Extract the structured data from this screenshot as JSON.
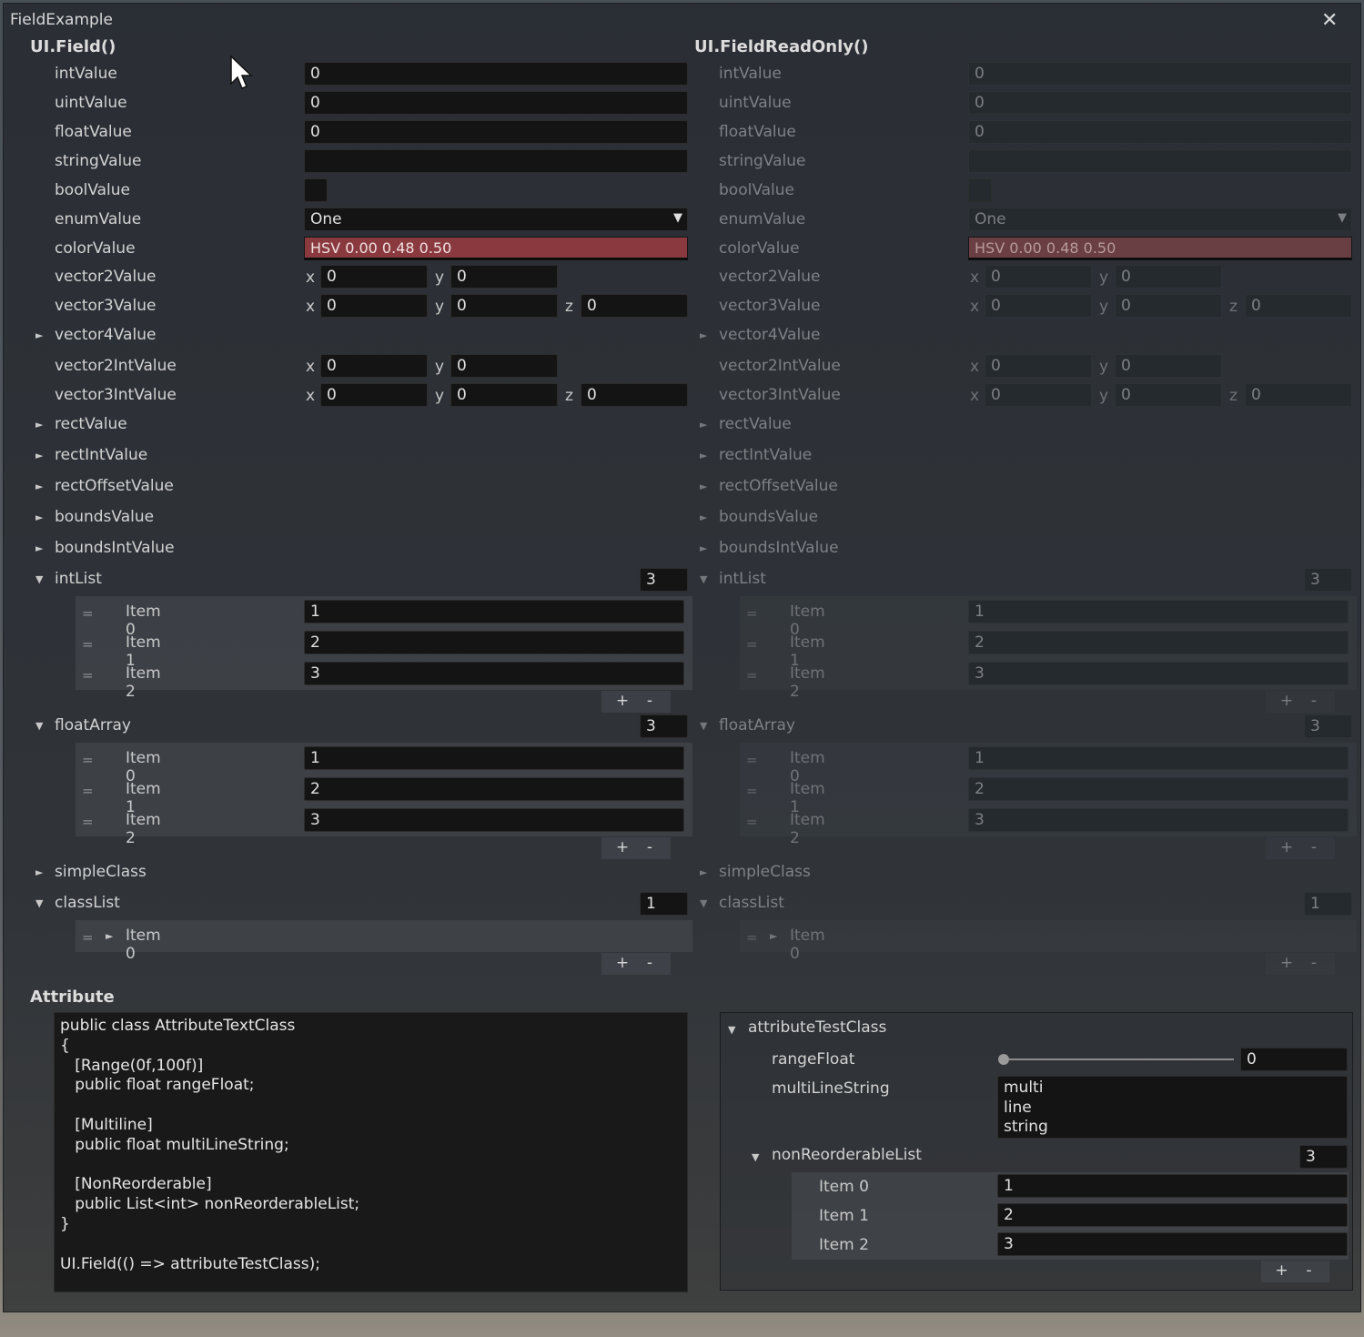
{
  "window": {
    "title": "FieldExample",
    "close_glyph": "✕"
  },
  "left": {
    "header": "UI.Field()"
  },
  "right": {
    "header": "UI.FieldReadOnly()"
  },
  "fields": {
    "intValue": {
      "label": "intValue",
      "value": "0"
    },
    "uintValue": {
      "label": "uintValue",
      "value": "0"
    },
    "floatValue": {
      "label": "floatValue",
      "value": "0"
    },
    "stringValue": {
      "label": "stringValue",
      "value": ""
    },
    "boolValue": {
      "label": "boolValue",
      "checked": false
    },
    "enumValue": {
      "label": "enumValue",
      "value": "One"
    },
    "colorValue": {
      "label": "colorValue",
      "value": "HSV 0.00 0.48 0.50",
      "color": "#8a3a3e"
    },
    "vector2Value": {
      "label": "vector2Value",
      "x": "0",
      "y": "0"
    },
    "vector3Value": {
      "label": "vector3Value",
      "x": "0",
      "y": "0",
      "z": "0"
    },
    "vector4Value": {
      "label": "vector4Value"
    },
    "vector2IntValue": {
      "label": "vector2IntValue",
      "x": "0",
      "y": "0"
    },
    "vector3IntValue": {
      "label": "vector3IntValue",
      "x": "0",
      "y": "0",
      "z": "0"
    },
    "rectValue": {
      "label": "rectValue"
    },
    "rectIntValue": {
      "label": "rectIntValue"
    },
    "rectOffsetValue": {
      "label": "rectOffsetValue"
    },
    "boundsValue": {
      "label": "boundsValue"
    },
    "boundsIntValue": {
      "label": "boundsIntValue"
    },
    "intList": {
      "label": "intList",
      "count": "3",
      "items": [
        {
          "label": "Item 0",
          "value": "1"
        },
        {
          "label": "Item 1",
          "value": "2"
        },
        {
          "label": "Item 2",
          "value": "3"
        }
      ]
    },
    "floatArray": {
      "label": "floatArray",
      "count": "3",
      "items": [
        {
          "label": "Item 0",
          "value": "1"
        },
        {
          "label": "Item 1",
          "value": "2"
        },
        {
          "label": "Item 2",
          "value": "3"
        }
      ]
    },
    "simpleClass": {
      "label": "simpleClass"
    },
    "classList": {
      "label": "classList",
      "count": "1",
      "items": [
        {
          "label": "Item 0"
        }
      ]
    }
  },
  "axis": {
    "x": "x",
    "y": "y",
    "z": "z"
  },
  "glyphs": {
    "expanded": "▼",
    "collapsed": "►",
    "handle": "=",
    "plus": "+",
    "minus": "-",
    "enum_arrow": "▼"
  },
  "attribute": {
    "header": "Attribute",
    "code": "public class AttributeTextClass\n{\n   [Range(0f,100f)]\n   public float rangeFloat;\n\n   [Multiline]\n   public float multiLineString;\n\n   [NonReorderable]\n   public List<int> nonReorderableList;\n}\n\nUI.Field(() => attributeTestClass);",
    "class_label": "attributeTestClass",
    "rangeFloat": {
      "label": "rangeFloat",
      "value": "0",
      "slider_fraction": 0
    },
    "multiLineString": {
      "label": "multiLineString",
      "lines": [
        "multi",
        "line",
        "string"
      ]
    },
    "nonReorderableList": {
      "label": "nonReorderableList",
      "count": "3",
      "items": [
        {
          "label": "Item 0",
          "value": "1"
        },
        {
          "label": "Item 1",
          "value": "2"
        },
        {
          "label": "Item 2",
          "value": "3"
        }
      ]
    }
  }
}
